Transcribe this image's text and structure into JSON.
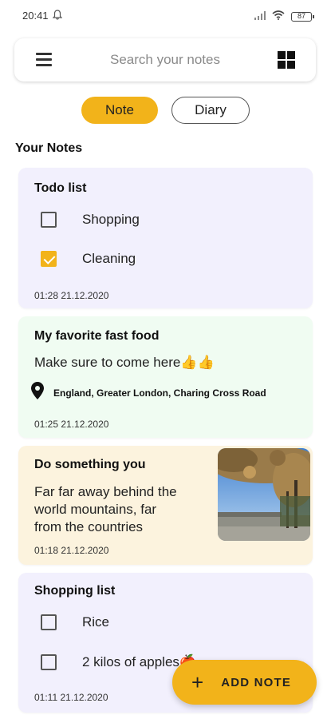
{
  "status_bar": {
    "time": "20:41",
    "battery": "87",
    "icons": [
      "bell-icon",
      "signal-icon",
      "wifi-icon",
      "battery-icon"
    ]
  },
  "search": {
    "placeholder": "Search your notes",
    "menu_icon": "hamburger-menu-icon",
    "view_icon": "grid-view-icon"
  },
  "tabs": [
    {
      "label": "Note",
      "selected": true
    },
    {
      "label": "Diary",
      "selected": false
    }
  ],
  "section_title": "Your Notes",
  "notes": [
    {
      "title": "Todo list",
      "type": "checklist",
      "items": [
        {
          "label": "Shopping",
          "checked": false
        },
        {
          "label": "Cleaning",
          "checked": true
        }
      ],
      "date": "01:28 21.12.2020",
      "color": "#f2f0fd"
    },
    {
      "title": "My favorite fast food",
      "type": "text",
      "body": "Make sure to come here👍👍",
      "location": "England, Greater London, Charing Cross Road",
      "date": "01:25 21.12.2020",
      "color": "#f0fcf2"
    },
    {
      "title": "Do something you",
      "type": "text",
      "body_lines": [
        "Far far away behind the",
        "world mountains, far",
        "from the countries"
      ],
      "date": "01:18 21.12.2020",
      "color": "#fcf3de"
    },
    {
      "title": "Shopping list",
      "type": "checklist",
      "items": [
        {
          "label": "Rice",
          "checked": false
        },
        {
          "label": "2 kilos of apples🍎",
          "checked": false
        }
      ],
      "date": "01:11 21.12.2020",
      "color": "#f2f0fd"
    }
  ],
  "fab": {
    "label": "ADD NOTE",
    "icon": "plus-icon"
  },
  "colors": {
    "accent": "#f2b31a"
  }
}
